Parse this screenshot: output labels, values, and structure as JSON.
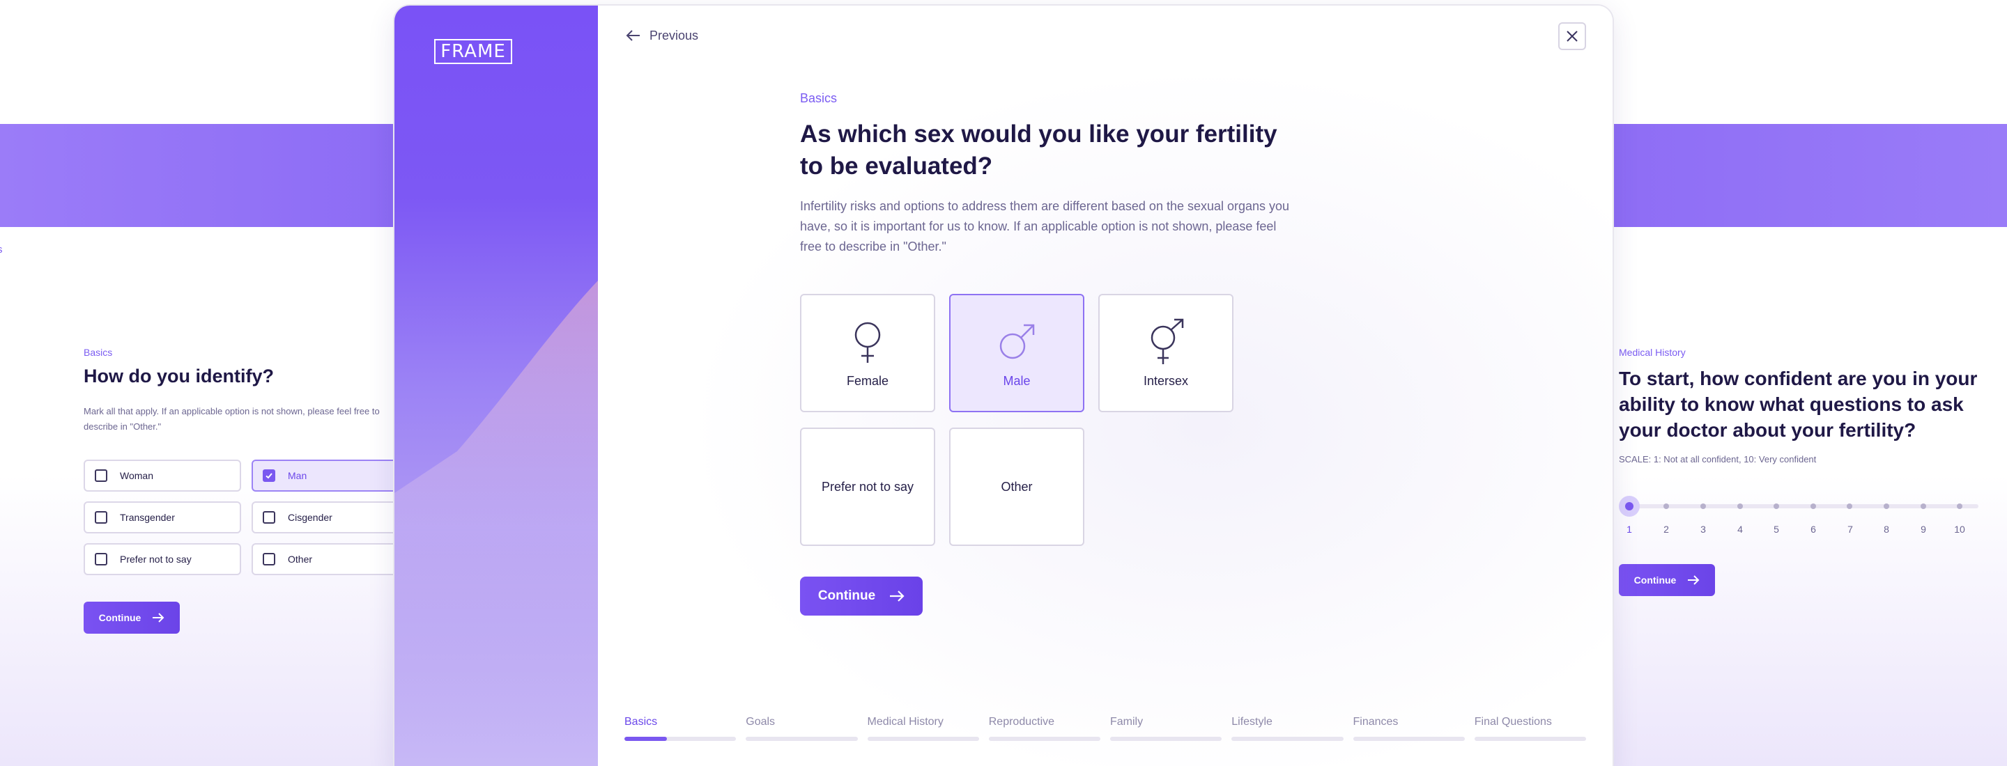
{
  "left_card": {
    "fragment_text": "s",
    "eyebrow": "Basics",
    "title": "How do you identify?",
    "description": "Mark all that apply. If an applicable option is not shown, please feel free to describe in \"Other.\"",
    "options": [
      {
        "label": "Woman",
        "selected": false
      },
      {
        "label": "Man",
        "selected": true
      },
      {
        "label": "Transgender",
        "selected": false
      },
      {
        "label": "Cisgender",
        "selected": false
      },
      {
        "label": "Prefer not to say",
        "selected": false
      },
      {
        "label": "Other",
        "selected": false
      }
    ],
    "continue_label": "Continue"
  },
  "modal": {
    "logo_text": "FRAME",
    "previous_label": "Previous",
    "eyebrow": "Basics",
    "title": "As which sex would you like your fertility to be evaluated?",
    "description": "Infertility risks and options to address them are different based on the sexual organs you have, so it is important for us to know. If an applicable option is not shown, please feel free to describe in \"Other.\"",
    "options": [
      {
        "label": "Female",
        "icon": "female-symbol-icon",
        "selected": false
      },
      {
        "label": "Male",
        "icon": "male-symbol-icon",
        "selected": true
      },
      {
        "label": "Intersex",
        "icon": "intersex-symbol-icon",
        "selected": false
      },
      {
        "label": "Prefer not to say",
        "icon": "",
        "selected": false
      },
      {
        "label": "Other",
        "icon": "",
        "selected": false
      }
    ],
    "continue_label": "Continue",
    "steps": [
      {
        "label": "Basics",
        "active": true,
        "progress": 0.38
      },
      {
        "label": "Goals",
        "active": false,
        "progress": 0
      },
      {
        "label": "Medical History",
        "active": false,
        "progress": 0
      },
      {
        "label": "Reproductive",
        "active": false,
        "progress": 0
      },
      {
        "label": "Family",
        "active": false,
        "progress": 0
      },
      {
        "label": "Lifestyle",
        "active": false,
        "progress": 0
      },
      {
        "label": "Finances",
        "active": false,
        "progress": 0
      },
      {
        "label": "Final Questions",
        "active": false,
        "progress": 0
      }
    ]
  },
  "right_card": {
    "eyebrow": "Medical History",
    "title": "To start, how confident are you in your ability to know what questions to ask your doctor about your fertility?",
    "scale_text": "SCALE: 1: Not at all confident, 10: Very confident",
    "scale_values": [
      "1",
      "2",
      "3",
      "4",
      "5",
      "6",
      "7",
      "8",
      "9",
      "10"
    ],
    "selected_value": "1",
    "continue_label": "Continue"
  },
  "colors": {
    "accent": "#7a58f0",
    "heading": "#1f1846",
    "body_text": "#6c6691",
    "selected_bg": "#ede7fe"
  }
}
